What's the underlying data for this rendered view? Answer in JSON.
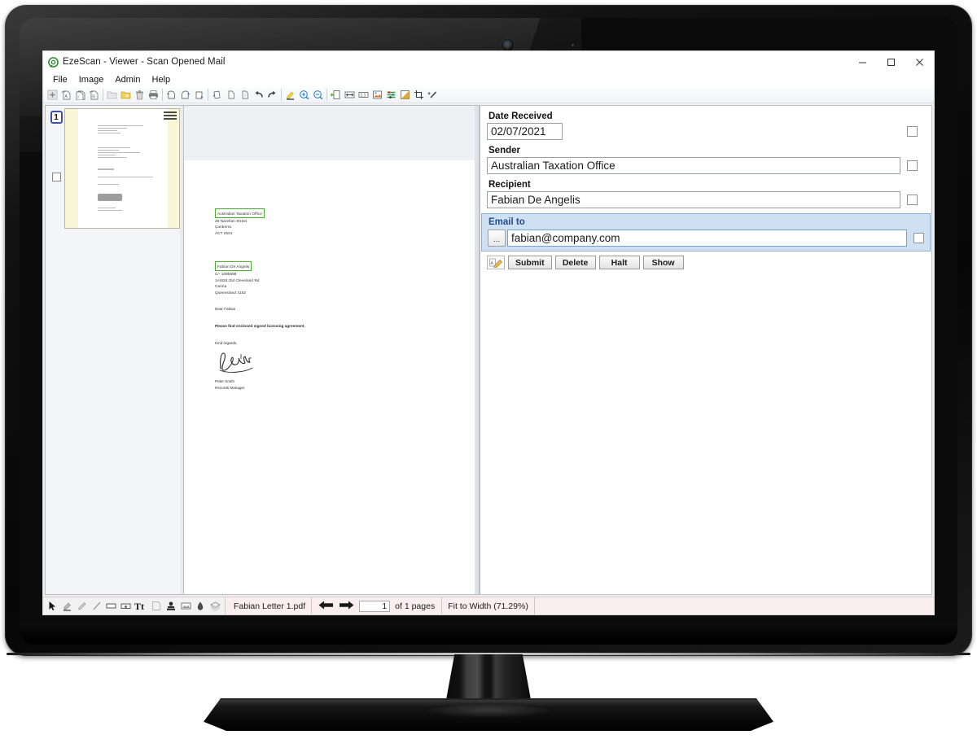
{
  "window": {
    "title": "EzeScan - Viewer - Scan Opened Mail",
    "logo_icon": "ezescan-logo-icon",
    "minimize_label": "–",
    "maximize_label": "☐",
    "close_label": "✕"
  },
  "menubar": {
    "items": [
      {
        "label": "File"
      },
      {
        "label": "Image"
      },
      {
        "label": "Admin"
      },
      {
        "label": "Help"
      }
    ]
  },
  "toolbar": {
    "buttons": [
      {
        "name": "add-page-icon"
      },
      {
        "name": "insert-page-after-icon"
      },
      {
        "name": "insert-pages-icon"
      },
      {
        "name": "replace-page-icon"
      },
      {
        "sep": true
      },
      {
        "name": "open-folder-icon"
      },
      {
        "name": "close-batch-icon"
      },
      {
        "name": "delete-icon"
      },
      {
        "name": "print-icon"
      },
      {
        "sep": true
      },
      {
        "name": "rotate-left-icon"
      },
      {
        "name": "rotate-right-icon"
      },
      {
        "name": "rotate-180-icon"
      },
      {
        "sep": true
      },
      {
        "name": "deskew-icon"
      },
      {
        "name": "copy-page-icon"
      },
      {
        "name": "paste-page-icon"
      },
      {
        "name": "undo-icon"
      },
      {
        "name": "redo-icon"
      },
      {
        "sep": true
      },
      {
        "name": "highlighter-icon"
      },
      {
        "name": "zoom-in-icon"
      },
      {
        "name": "zoom-out-icon"
      },
      {
        "sep": true
      },
      {
        "name": "fit-page-icon"
      },
      {
        "name": "fit-width-icon"
      },
      {
        "name": "actual-size-icon"
      },
      {
        "name": "image-adjust-icon"
      },
      {
        "name": "levels-icon"
      },
      {
        "name": "contrast-icon"
      },
      {
        "name": "crop-icon"
      },
      {
        "name": "auto-enhance-icon"
      }
    ]
  },
  "thumbnails": {
    "pages": [
      {
        "number": "1",
        "selected": true,
        "checked": false
      }
    ]
  },
  "document": {
    "sender_block": {
      "highlighted_line": "Australian Taxation Office",
      "lines": [
        "26 Narellan Street",
        "Canberra",
        "ACT 2601"
      ]
    },
    "recipient_block": {
      "highlighted_line": "Fabian De Angelis",
      "lines": [
        "C/- 1085699",
        "1A/828 Old Cleveland Rd",
        "Carina",
        "Queensland 4152"
      ]
    },
    "salutation": "Dear Fabian",
    "body": "Please find enclosed signed licensing agreement.",
    "closing": "Kind regards,",
    "signature_icon": "handwritten-signature-icon",
    "signer_name": "Peter Smith",
    "signer_title": "Records Manager"
  },
  "form": {
    "fields": [
      {
        "label": "Date Received",
        "value": "02/07/2021",
        "type": "date",
        "checked": false,
        "highlighted": false
      },
      {
        "label": "Sender",
        "value": "Australian Taxation Office",
        "type": "text",
        "checked": false,
        "highlighted": false
      },
      {
        "label": "Recipient",
        "value": "Fabian De Angelis",
        "type": "text",
        "checked": false,
        "highlighted": false
      }
    ],
    "email_field": {
      "label": "Email to",
      "value": "fabian@company.com",
      "browse_label": "...",
      "checked": false,
      "highlighted": true
    },
    "buttons": [
      {
        "label": "Submit",
        "name": "submit-button"
      },
      {
        "label": "Delete",
        "name": "delete-button"
      },
      {
        "label": "Halt",
        "name": "halt-button"
      },
      {
        "label": "Show",
        "name": "show-button"
      }
    ],
    "edit_icon": "edit-fields-icon",
    "highlight_color": "#cfe0f2",
    "highlight_border": "#8ab0d8",
    "highlight_label_color": "#1f4e8c"
  },
  "statusbar": {
    "annotation_tools": [
      {
        "name": "select-arrow-icon"
      },
      {
        "name": "highlighter-tool-icon"
      },
      {
        "name": "pencil-tool-icon"
      },
      {
        "name": "line-tool-icon"
      },
      {
        "name": "rectangle-tool-icon"
      },
      {
        "name": "sticky-note-icon"
      },
      {
        "name": "text-tool-icon"
      },
      {
        "name": "blank-note-icon"
      },
      {
        "name": "stamp-icon"
      },
      {
        "name": "image-stamp-icon"
      },
      {
        "name": "redaction-icon"
      },
      {
        "name": "layers-icon"
      }
    ],
    "filename": "Fabian Letter 1.pdf",
    "prev_page_icon": "arrow-left-icon",
    "next_page_icon": "arrow-right-icon",
    "current_page": "1",
    "page_count_label": "of 1 pages",
    "zoom_label": "Fit to Width (71.29%)"
  },
  "colors": {
    "accent_green": "#4caf32",
    "thumb_paper": "#faf6d8",
    "status_bg": "#fbeef0"
  }
}
